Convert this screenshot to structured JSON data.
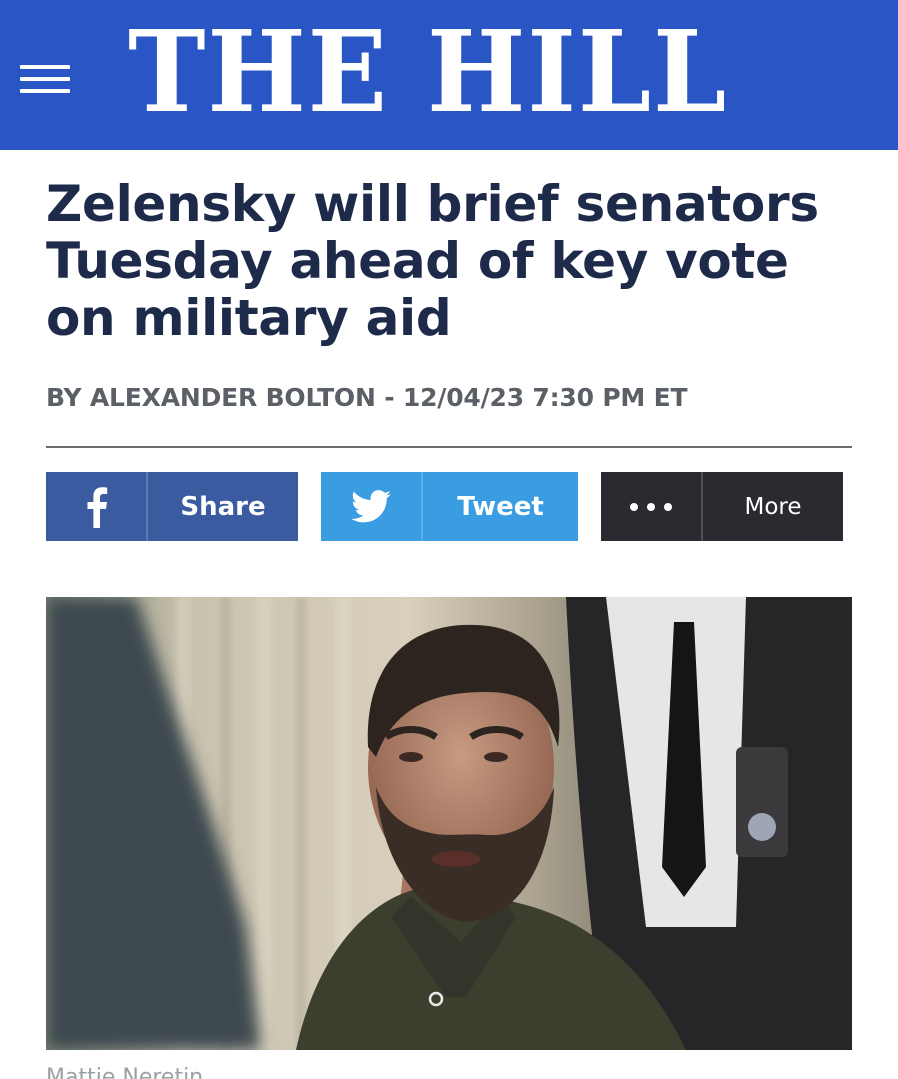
{
  "header": {
    "logo_text": "THE HILL",
    "bg_color": "#2a55c4"
  },
  "article": {
    "headline": "Zelensky will brief senators Tuesday ahead of key vote on military aid",
    "byline": "BY ALEXANDER BOLTON - 12/04/23 7:30 PM ET",
    "photo_credit": "Mattie Neretin"
  },
  "share": {
    "facebook_label": "Share",
    "twitter_label": "Tweet",
    "more_label": "More",
    "facebook_color": "#3b5ba0",
    "twitter_color": "#3a9de2",
    "more_color": "#2a2b30"
  },
  "icons": {
    "menu": "hamburger-menu-icon",
    "facebook": "facebook-icon",
    "twitter": "twitter-bird-icon",
    "more": "ellipsis-icon"
  }
}
